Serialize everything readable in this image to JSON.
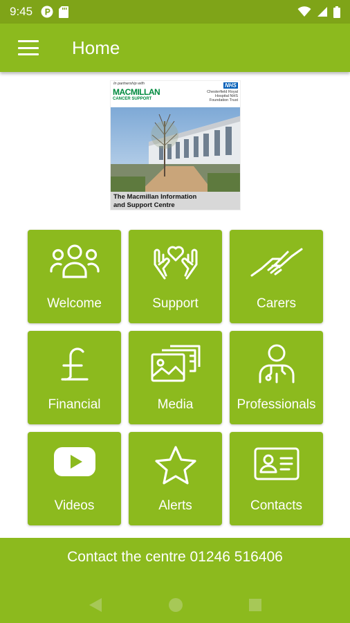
{
  "status_bar": {
    "time": "9:45",
    "icons_left": [
      "p-icon",
      "sd-card-icon"
    ],
    "icons_right": [
      "wifi-icon",
      "signal-icon",
      "battery-icon"
    ]
  },
  "app_bar": {
    "title": "Home",
    "menu_icon": "hamburger-icon"
  },
  "banner": {
    "partnership_text": "In partnership with",
    "macmillan_name": "MACMILLAN",
    "macmillan_sub": "CANCER SUPPORT",
    "nhs": "NHS",
    "hospital": "Chesterfield Royal Hospital NHS Foundation Trust",
    "caption_line1": "The Macmillan Information",
    "caption_line2": "and Support Centre"
  },
  "tiles": [
    {
      "label": "Welcome",
      "icon": "people-group-icon"
    },
    {
      "label": "Support",
      "icon": "hands-heart-icon"
    },
    {
      "label": "Carers",
      "icon": "handshake-icon"
    },
    {
      "label": "Financial",
      "icon": "pound-icon"
    },
    {
      "label": "Media",
      "icon": "photos-icon"
    },
    {
      "label": "Professionals",
      "icon": "doctor-icon"
    },
    {
      "label": "Videos",
      "icon": "youtube-icon"
    },
    {
      "label": "Alerts",
      "icon": "star-icon"
    },
    {
      "label": "Contacts",
      "icon": "id-card-icon"
    }
  ],
  "footer": {
    "contact_text": "Contact the centre 01246 516406"
  },
  "nav": {
    "back": "back-icon",
    "home": "home-icon",
    "recents": "recents-icon"
  },
  "colors": {
    "primary": "#8cba1e",
    "status_bar": "#7fa418",
    "nav_icons": "#a7c857"
  }
}
